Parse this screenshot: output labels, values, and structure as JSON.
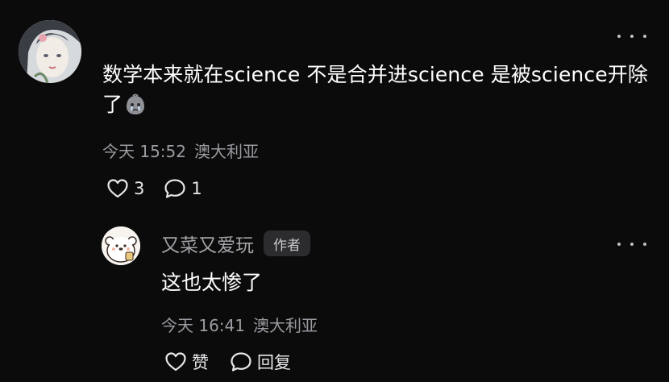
{
  "comment": {
    "text": "数学本来就在science 不是合并进science 是被science开除了",
    "time": "今天 15:52",
    "location": "澳大利亚",
    "like_count": "3",
    "reply_count": "1"
  },
  "reply": {
    "username": "又菜又爱玩",
    "badge": "作者",
    "text": "这也太惨了",
    "time": "今天 16:41",
    "location": "澳大利亚",
    "like_label": "赞",
    "reply_label": "回复"
  },
  "icons": {
    "more": "more-dots-icon",
    "like": "heart-outline-icon",
    "comment": "speech-bubble-icon",
    "emoji": "crying-face-icon"
  },
  "colors": {
    "background": "#0b0b0c",
    "text_primary": "#ffffff",
    "text_secondary": "#9a9ba0",
    "badge_bg": "#2c2c2e"
  }
}
